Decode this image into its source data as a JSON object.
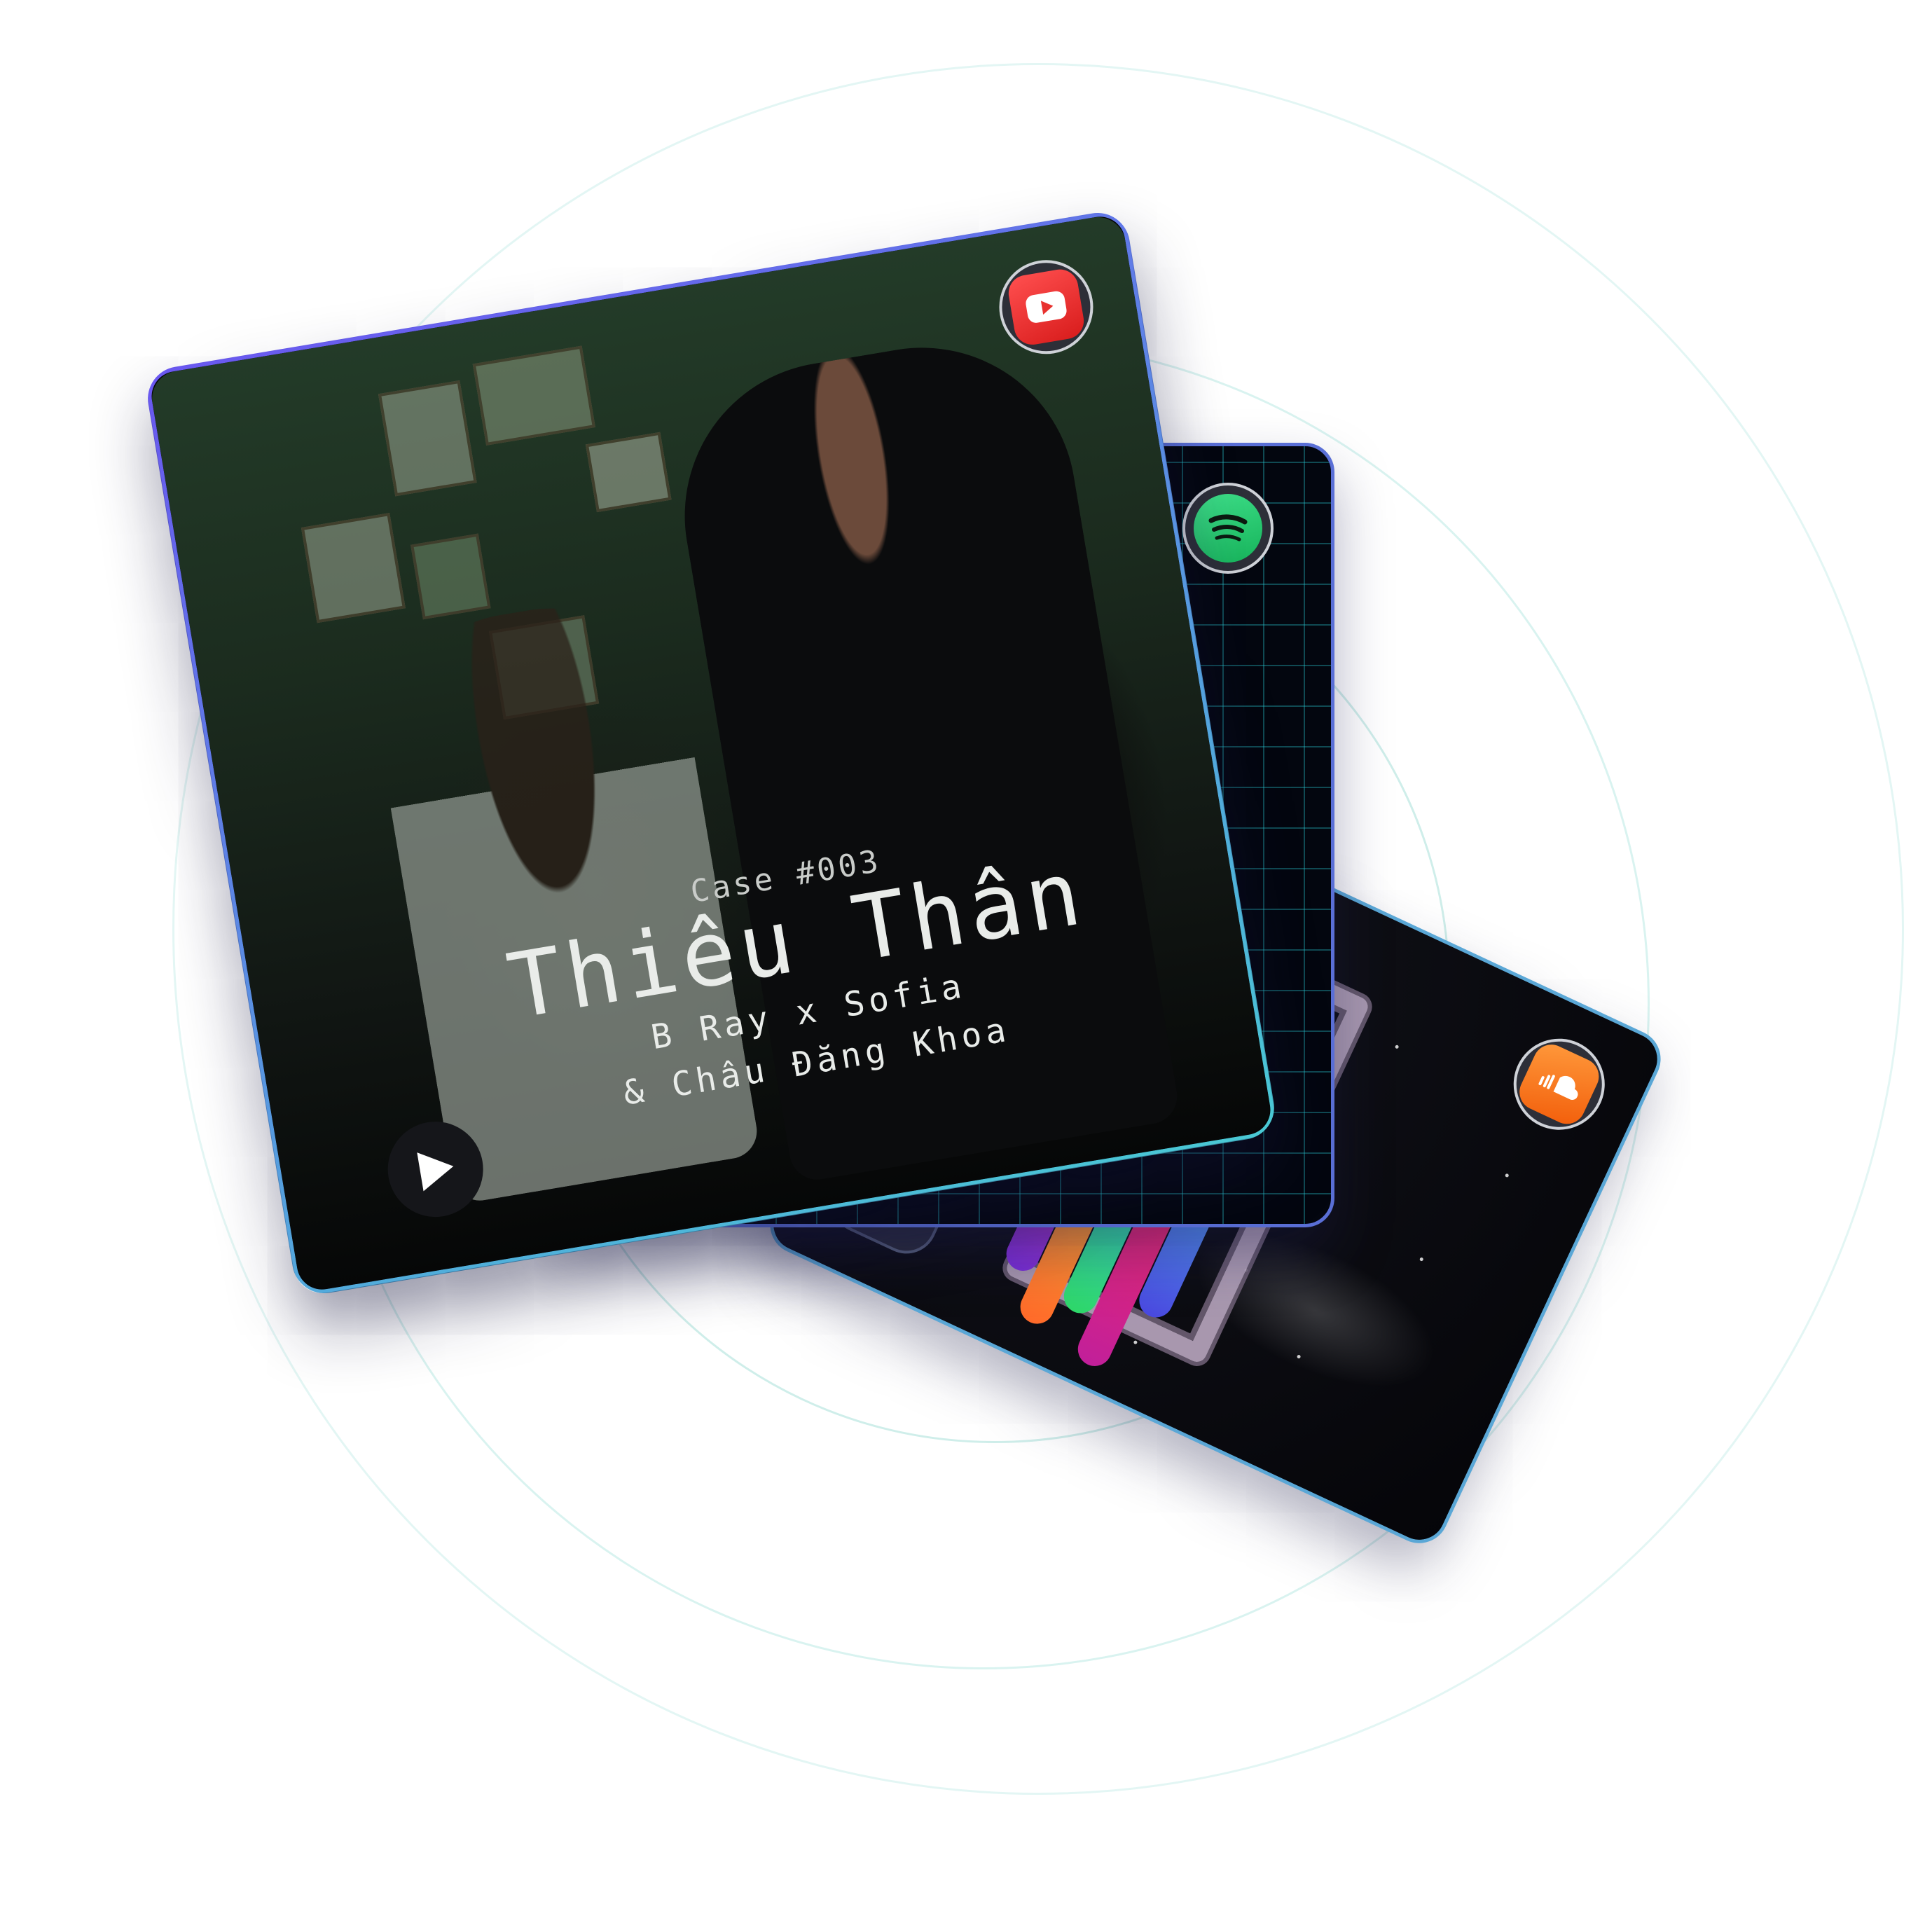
{
  "cards": [
    {
      "platform": "YouTube",
      "icon": "youtube-icon",
      "accent": "#e8322f",
      "case_label": "Case #003",
      "title": "Thiêu Thân",
      "artists_line1": "B Ray x Sofia",
      "artists_line2": "& Châu Đăng Khoa",
      "play_label": "▶"
    },
    {
      "platform": "Spotify",
      "icon": "spotify-icon",
      "accent": "#1fc865"
    },
    {
      "platform": "SoundCloud",
      "icon": "soundcloud-icon",
      "accent": "#f36e1c",
      "play_label": "▲"
    }
  ],
  "colors": {
    "ring": "#d3f1ee",
    "card_border_start": "#6a57f0",
    "card_border_end": "#49c9d4"
  }
}
